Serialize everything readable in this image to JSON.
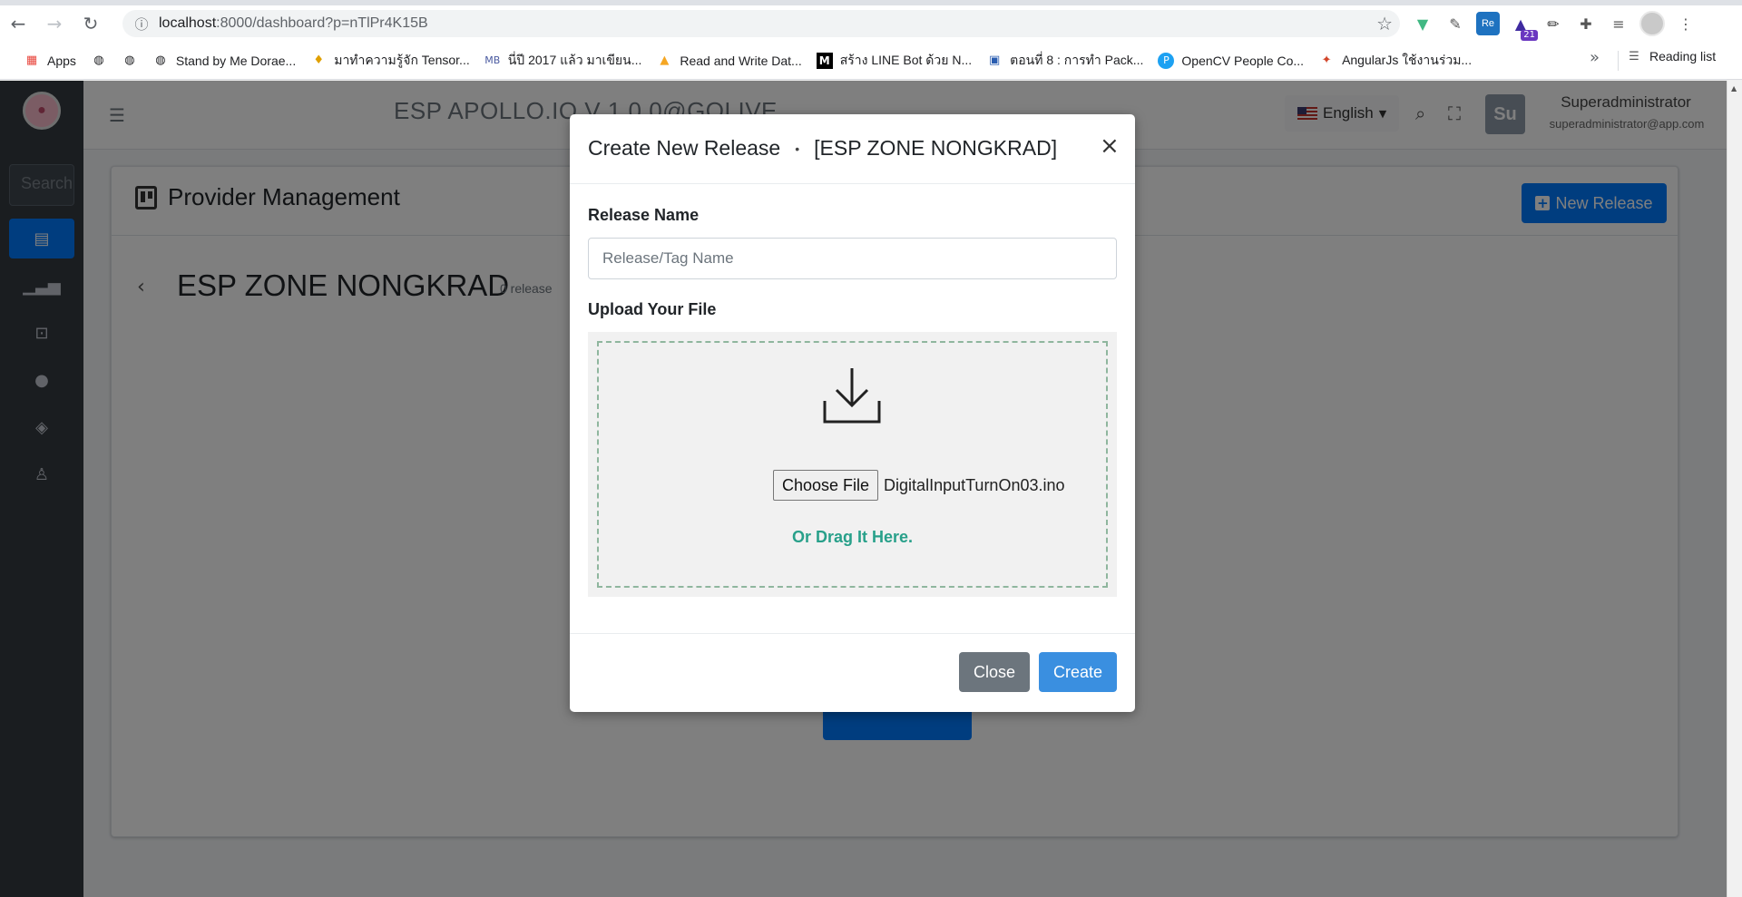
{
  "browser": {
    "url_host": "localhost",
    "url_path": ":8000/dashboard?p=nTlPr4K15B",
    "bookmarks": [
      {
        "label": "Apps",
        "icon": "apps-grid-icon"
      },
      {
        "label": "",
        "icon": "globe-icon"
      },
      {
        "label": "",
        "icon": "globe-icon"
      },
      {
        "label": "Stand by Me Dorae...",
        "icon": "globe-icon"
      },
      {
        "label": "มาทำความรู้จัก Tensor...",
        "icon": "bulb-icon"
      },
      {
        "label": "นี่ปี 2017 แล้ว มาเขียน...",
        "icon": "mb-icon"
      },
      {
        "label": "Read and Write Dat...",
        "icon": "firebase-icon"
      },
      {
        "label": "สร้าง LINE Bot ด้วย N...",
        "icon": "medium-icon"
      },
      {
        "label": "ตอนที่ 8 : การทำ Pack...",
        "icon": "page-icon"
      },
      {
        "label": "OpenCV People Co...",
        "icon": "p-icon"
      },
      {
        "label": "AngularJs ใช้งานร่วม...",
        "icon": "fox-icon"
      }
    ],
    "more": "»",
    "reading_list": "Reading list",
    "ext_badge": "21"
  },
  "app": {
    "title": "ESP APOLLO.IO V 1.0.0@GOLIVE",
    "search_placeholder": "Search",
    "language": "English",
    "user_initials": "Su",
    "user_name": "Superadministrator",
    "user_email": "superadministrator@app.com"
  },
  "page": {
    "header_title": "Provider Management",
    "new_release_label": "New Release",
    "zone_name": "ESP ZONE NONGKRAD",
    "release_count": "0 release"
  },
  "modal": {
    "title": "Create New Release",
    "dot": "•",
    "zone": "[ESP ZONE NONGKRAD]",
    "close_x": "×",
    "release_name_label": "Release Name",
    "release_name_placeholder": "Release/Tag Name",
    "release_name_value": "",
    "upload_label": "Upload Your File",
    "choose_file_label": "Choose File",
    "file_name": "DigitalInputTurnOn03.ino",
    "drag_text": "Or Drag It Here.",
    "close_button": "Close",
    "create_button": "Create"
  },
  "colors": {
    "primary": "#007bff",
    "sidebar": "#343a40",
    "drag_text": "#28a08a",
    "close_btn": "#6c757d"
  }
}
